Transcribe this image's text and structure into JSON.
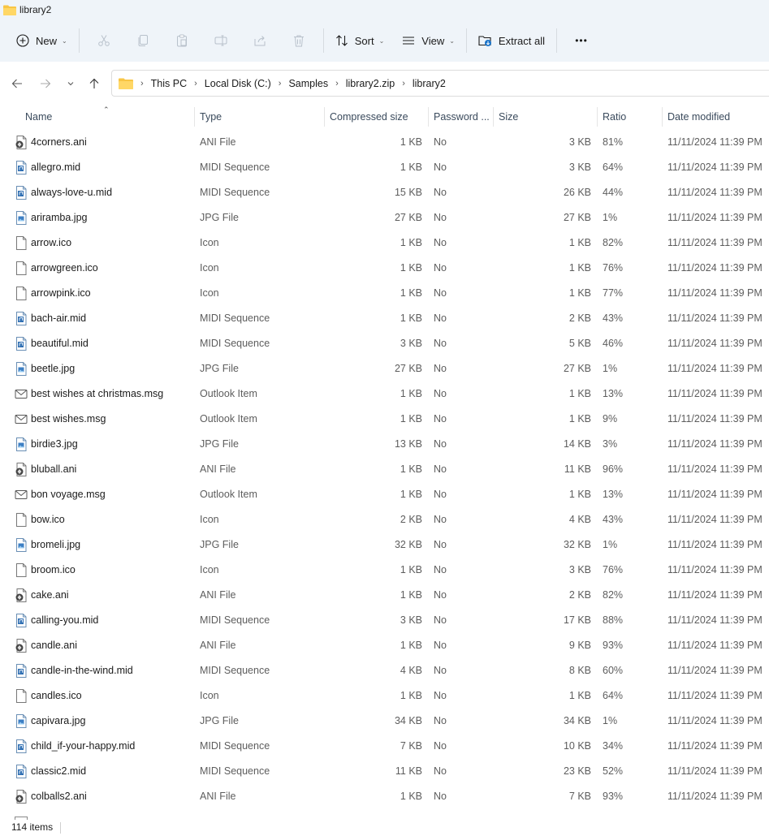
{
  "window": {
    "title": "library2"
  },
  "toolbar": {
    "new_label": "New",
    "sort_label": "Sort",
    "view_label": "View",
    "extract_label": "Extract all",
    "more_label": "•••"
  },
  "address": {
    "crumbs": [
      "This PC",
      "Local Disk (C:)",
      "Samples",
      "library2.zip",
      "library2"
    ]
  },
  "columns": {
    "name": "Name",
    "type": "Type",
    "compressed": "Compressed size",
    "password": "Password ...",
    "size": "Size",
    "ratio": "Ratio",
    "date": "Date modified"
  },
  "files": [
    {
      "icon": "ani-file-icon",
      "name": "4corners.ani",
      "type": "ANI File",
      "compressed": "1 KB",
      "password": "No",
      "size": "3 KB",
      "ratio": "81%",
      "date": "11/11/2024 11:39 PM"
    },
    {
      "icon": "midi-file-icon",
      "name": "allegro.mid",
      "type": "MIDI Sequence",
      "compressed": "1 KB",
      "password": "No",
      "size": "3 KB",
      "ratio": "64%",
      "date": "11/11/2024 11:39 PM"
    },
    {
      "icon": "midi-file-icon",
      "name": "always-love-u.mid",
      "type": "MIDI Sequence",
      "compressed": "15 KB",
      "password": "No",
      "size": "26 KB",
      "ratio": "44%",
      "date": "11/11/2024 11:39 PM"
    },
    {
      "icon": "image-file-icon",
      "name": "ariramba.jpg",
      "type": "JPG File",
      "compressed": "27 KB",
      "password": "No",
      "size": "27 KB",
      "ratio": "1%",
      "date": "11/11/2024 11:39 PM"
    },
    {
      "icon": "blank-file-icon",
      "name": "arrow.ico",
      "type": "Icon",
      "compressed": "1 KB",
      "password": "No",
      "size": "1 KB",
      "ratio": "82%",
      "date": "11/11/2024 11:39 PM"
    },
    {
      "icon": "blank-file-icon",
      "name": "arrowgreen.ico",
      "type": "Icon",
      "compressed": "1 KB",
      "password": "No",
      "size": "1 KB",
      "ratio": "76%",
      "date": "11/11/2024 11:39 PM"
    },
    {
      "icon": "blank-file-icon",
      "name": "arrowpink.ico",
      "type": "Icon",
      "compressed": "1 KB",
      "password": "No",
      "size": "1 KB",
      "ratio": "77%",
      "date": "11/11/2024 11:39 PM"
    },
    {
      "icon": "midi-file-icon",
      "name": "bach-air.mid",
      "type": "MIDI Sequence",
      "compressed": "1 KB",
      "password": "No",
      "size": "2 KB",
      "ratio": "43%",
      "date": "11/11/2024 11:39 PM"
    },
    {
      "icon": "midi-file-icon",
      "name": "beautiful.mid",
      "type": "MIDI Sequence",
      "compressed": "3 KB",
      "password": "No",
      "size": "5 KB",
      "ratio": "46%",
      "date": "11/11/2024 11:39 PM"
    },
    {
      "icon": "image-file-icon",
      "name": "beetle.jpg",
      "type": "JPG File",
      "compressed": "27 KB",
      "password": "No",
      "size": "27 KB",
      "ratio": "1%",
      "date": "11/11/2024 11:39 PM"
    },
    {
      "icon": "mail-icon",
      "name": "best wishes at christmas.msg",
      "type": "Outlook Item",
      "compressed": "1 KB",
      "password": "No",
      "size": "1 KB",
      "ratio": "13%",
      "date": "11/11/2024 11:39 PM"
    },
    {
      "icon": "mail-icon",
      "name": "best wishes.msg",
      "type": "Outlook Item",
      "compressed": "1 KB",
      "password": "No",
      "size": "1 KB",
      "ratio": "9%",
      "date": "11/11/2024 11:39 PM"
    },
    {
      "icon": "image-file-icon",
      "name": "birdie3.jpg",
      "type": "JPG File",
      "compressed": "13 KB",
      "password": "No",
      "size": "14 KB",
      "ratio": "3%",
      "date": "11/11/2024 11:39 PM"
    },
    {
      "icon": "ani-file-icon",
      "name": "bluball.ani",
      "type": "ANI File",
      "compressed": "1 KB",
      "password": "No",
      "size": "11 KB",
      "ratio": "96%",
      "date": "11/11/2024 11:39 PM"
    },
    {
      "icon": "mail-icon",
      "name": "bon voyage.msg",
      "type": "Outlook Item",
      "compressed": "1 KB",
      "password": "No",
      "size": "1 KB",
      "ratio": "13%",
      "date": "11/11/2024 11:39 PM"
    },
    {
      "icon": "blank-file-icon",
      "name": "bow.ico",
      "type": "Icon",
      "compressed": "2 KB",
      "password": "No",
      "size": "4 KB",
      "ratio": "43%",
      "date": "11/11/2024 11:39 PM"
    },
    {
      "icon": "image-file-icon",
      "name": "bromeli.jpg",
      "type": "JPG File",
      "compressed": "32 KB",
      "password": "No",
      "size": "32 KB",
      "ratio": "1%",
      "date": "11/11/2024 11:39 PM"
    },
    {
      "icon": "blank-file-icon",
      "name": "broom.ico",
      "type": "Icon",
      "compressed": "1 KB",
      "password": "No",
      "size": "3 KB",
      "ratio": "76%",
      "date": "11/11/2024 11:39 PM"
    },
    {
      "icon": "ani-file-icon",
      "name": "cake.ani",
      "type": "ANI File",
      "compressed": "1 KB",
      "password": "No",
      "size": "2 KB",
      "ratio": "82%",
      "date": "11/11/2024 11:39 PM"
    },
    {
      "icon": "midi-file-icon",
      "name": "calling-you.mid",
      "type": "MIDI Sequence",
      "compressed": "3 KB",
      "password": "No",
      "size": "17 KB",
      "ratio": "88%",
      "date": "11/11/2024 11:39 PM"
    },
    {
      "icon": "ani-file-icon",
      "name": "candle.ani",
      "type": "ANI File",
      "compressed": "1 KB",
      "password": "No",
      "size": "9 KB",
      "ratio": "93%",
      "date": "11/11/2024 11:39 PM"
    },
    {
      "icon": "midi-file-icon",
      "name": "candle-in-the-wind.mid",
      "type": "MIDI Sequence",
      "compressed": "4 KB",
      "password": "No",
      "size": "8 KB",
      "ratio": "60%",
      "date": "11/11/2024 11:39 PM"
    },
    {
      "icon": "blank-file-icon",
      "name": "candles.ico",
      "type": "Icon",
      "compressed": "1 KB",
      "password": "No",
      "size": "1 KB",
      "ratio": "64%",
      "date": "11/11/2024 11:39 PM"
    },
    {
      "icon": "image-file-icon",
      "name": "capivara.jpg",
      "type": "JPG File",
      "compressed": "34 KB",
      "password": "No",
      "size": "34 KB",
      "ratio": "1%",
      "date": "11/11/2024 11:39 PM"
    },
    {
      "icon": "midi-file-icon",
      "name": "child_if-your-happy.mid",
      "type": "MIDI Sequence",
      "compressed": "7 KB",
      "password": "No",
      "size": "10 KB",
      "ratio": "34%",
      "date": "11/11/2024 11:39 PM"
    },
    {
      "icon": "midi-file-icon",
      "name": "classic2.mid",
      "type": "MIDI Sequence",
      "compressed": "11 KB",
      "password": "No",
      "size": "23 KB",
      "ratio": "52%",
      "date": "11/11/2024 11:39 PM"
    },
    {
      "icon": "ani-file-icon",
      "name": "colballs2.ani",
      "type": "ANI File",
      "compressed": "1 KB",
      "password": "No",
      "size": "7 KB",
      "ratio": "93%",
      "date": "11/11/2024 11:39 PM"
    }
  ],
  "status": {
    "item_count": "114 items"
  }
}
